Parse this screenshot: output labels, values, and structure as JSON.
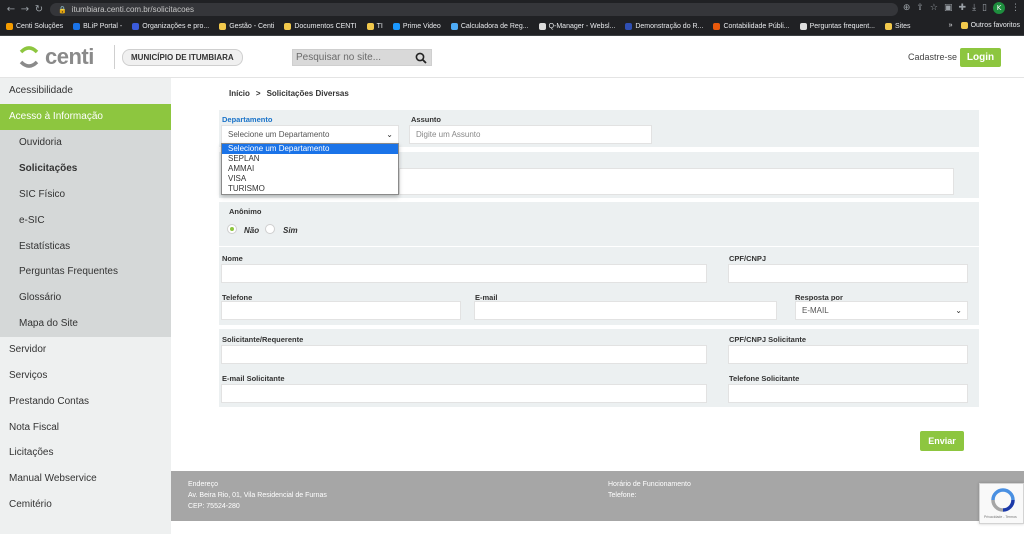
{
  "browser": {
    "url": "itumbiara.centi.com.br/solicitacoes",
    "bookmarks": [
      {
        "label": "Centi Soluções",
        "color": "#f59c00"
      },
      {
        "label": "BLiP Portal -",
        "color": "#1a73e8"
      },
      {
        "label": "Organizações e pro...",
        "color": "#3b5bdb"
      },
      {
        "label": "Gestão - Centi",
        "color": "#f2c94c"
      },
      {
        "label": "Documentos CENTI",
        "color": "#f2c94c"
      },
      {
        "label": "TI",
        "color": "#f2c94c"
      },
      {
        "label": "Prime Video",
        "color": "#1a98ff"
      },
      {
        "label": "Calculadora de Reg...",
        "color": "#4dabf7"
      },
      {
        "label": "Q-Manager - Websl...",
        "color": "#dddddd"
      },
      {
        "label": "Demonstração do R...",
        "color": "#2f4fb3"
      },
      {
        "label": "Contabilidade Públi...",
        "color": "#e8590c"
      },
      {
        "label": "Perguntas frequent...",
        "color": "#dddddd"
      },
      {
        "label": "Sites",
        "color": "#f2c94c"
      }
    ],
    "other_favorites": "Outros favoritos",
    "avatar_letter": "K"
  },
  "header": {
    "logo_text": "centi",
    "municipality": "MUNICÍPIO DE ITUMBIARA",
    "search_placeholder": "Pesquisar no site...",
    "signup": "Cadastre-se",
    "login": "Login"
  },
  "sidebar": {
    "items": [
      "Acessibilidade",
      "Acesso à Informação"
    ],
    "sub_items": [
      "Ouvidoria",
      "Solicitações",
      "SIC Físico",
      "e-SIC",
      "Estatísticas",
      "Perguntas Frequentes",
      "Glossário",
      "Mapa do Site"
    ],
    "more_items": [
      "Servidor",
      "Serviços",
      "Prestando Contas",
      "Nota Fiscal",
      "Licitações",
      "Manual Webservice",
      "Cemitério"
    ]
  },
  "breadcrumb": {
    "home": "Início",
    "separator": ">",
    "current": "Solicitações Diversas"
  },
  "form": {
    "departamento_label": "Departamento",
    "departamento_value": "Selecione um Departamento",
    "departamento_options": [
      "Selecione um Departamento",
      "SEPLAN",
      "AMMAI",
      "VISA",
      "TURISMO"
    ],
    "assunto_label": "Assunto",
    "assunto_placeholder": "Digite um Assunto",
    "anonimo_label": "Anônimo",
    "anonimo_no": "Não",
    "anonimo_yes": "Sim",
    "nome_label": "Nome",
    "cpf_label": "CPF/CNPJ",
    "telefone_label": "Telefone",
    "email_label": "E-mail",
    "resposta_label": "Resposta por",
    "resposta_value": "E-MAIL",
    "solicitante_label": "Solicitante/Requerente",
    "cpf_solicitante_label": "CPF/CNPJ Solicitante",
    "email_solicitante_label": "E-mail Solicitante",
    "telefone_solicitante_label": "Telefone Solicitante",
    "submit": "Enviar"
  },
  "footer": {
    "address_title": "Endereço",
    "address_line1": "Av. Beira Rio, 01, Vila Residencial de Furnas",
    "address_line2": "CEP: 75524-280",
    "hours_title": "Horário de Funcionamento",
    "phone_label": "Telefone:",
    "recaptcha_text": "Privacidade - Termos"
  },
  "colors": {
    "accent": "#8dc63f",
    "panel": "#ecf0f1",
    "footer": "#a6a6a6"
  }
}
